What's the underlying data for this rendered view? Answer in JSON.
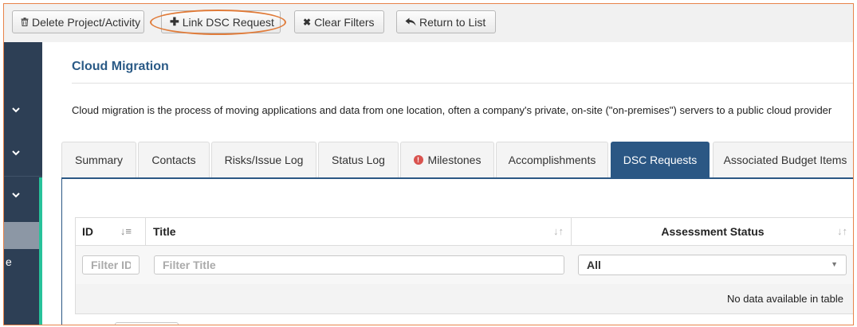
{
  "toolbar": {
    "delete_label": "Delete Project/Activity",
    "link_label": "Link DSC Request",
    "clear_label": "Clear Filters",
    "return_label": "Return to List"
  },
  "sidebar": {
    "partial_label": "e"
  },
  "page": {
    "title": "Cloud Migration",
    "description": "Cloud migration is the process of moving applications and data from one location, often a company's private, on-site (\"on-premises\") servers to a public cloud provider"
  },
  "tabs": [
    {
      "label": "Summary"
    },
    {
      "label": "Contacts"
    },
    {
      "label": "Risks/Issue Log"
    },
    {
      "label": "Status Log"
    },
    {
      "label": "Milestones",
      "alert": "!"
    },
    {
      "label": "Accomplishments"
    },
    {
      "label": "DSC Requests",
      "active": true
    },
    {
      "label": "Associated Budget Items"
    }
  ],
  "table": {
    "columns": [
      "ID",
      "Title",
      "Assessment Status"
    ],
    "filters": {
      "id_placeholder": "Filter ID",
      "title_placeholder": "Filter Title",
      "status_value": "All"
    },
    "empty_message": "No data available in table"
  },
  "colors": {
    "accent": "#2b5784",
    "highlight": "#e07b39",
    "sidebar": "#2d3f55",
    "sidebar_accent": "#27c29a",
    "title": "#2a5a86"
  }
}
